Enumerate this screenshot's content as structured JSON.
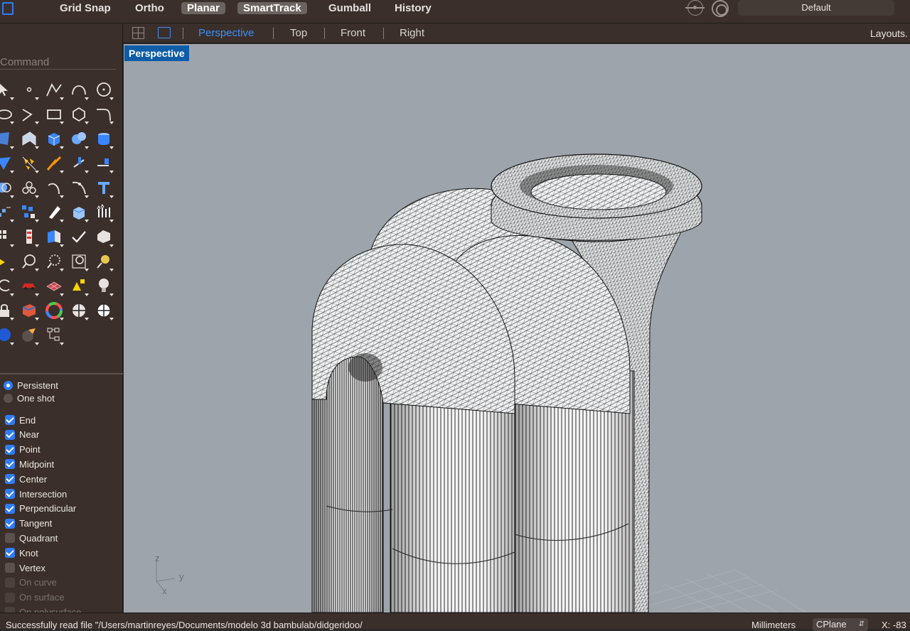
{
  "toolbar": {
    "buttons": [
      {
        "label": "Grid Snap",
        "active": false
      },
      {
        "label": "Ortho",
        "active": false
      },
      {
        "label": "Planar",
        "active": true
      },
      {
        "label": "SmartTrack",
        "active": true
      },
      {
        "label": "Gumball",
        "active": false
      },
      {
        "label": "History",
        "active": false
      }
    ],
    "layer_value": "Default"
  },
  "viewport_tabs": {
    "tabs": [
      {
        "label": "Perspective",
        "active": true
      },
      {
        "label": "Top",
        "active": false
      },
      {
        "label": "Front",
        "active": false
      },
      {
        "label": "Right",
        "active": false
      }
    ],
    "layouts_label": "Layouts."
  },
  "viewport": {
    "title": "Perspective",
    "axes": {
      "z": "z",
      "y": "y",
      "x": "x"
    }
  },
  "sidebar": {
    "command_placeholder": "Command",
    "tool_icons": [
      [
        "select-arrow-icon",
        "point-icon",
        "polyline-icon",
        "curve-icon",
        "circle-icon"
      ],
      [
        "ellipse-icon",
        "arc-icon",
        "rectangle-icon",
        "polygon-icon",
        "fillet-icon"
      ],
      [
        "surface-icon",
        "extrude-surface-icon",
        "box-icon",
        "sphere-icon",
        "cylinder-icon"
      ],
      [
        "patch-icon",
        "explode-icon",
        "split-icon",
        "trim-icon",
        "extend-icon"
      ],
      [
        "boolean-icon",
        "group-icon",
        "offset-icon",
        "curve-edit-icon",
        "text-icon"
      ],
      [
        "array-icon",
        "transform-icon",
        "mirror-icon",
        "solid-icon",
        "move-icon"
      ],
      [
        "grid-icon",
        "dimension-icon",
        "layer-icon",
        "check-icon",
        "analyze-icon"
      ],
      [
        "lasso-icon",
        "zoom-icon",
        "zoom-window-icon",
        "zoom-extents-icon",
        "light-icon"
      ],
      [
        "rotate-view-icon",
        "car-icon",
        "mesh-icon",
        "align-icon",
        "lightbulb-icon"
      ],
      [
        "lock-icon",
        "material-icon",
        "color-wheel-icon",
        "environment-icon",
        "sun-sphere-icon"
      ],
      [
        "render-icon",
        "flash-icon",
        "hierarchy-icon"
      ]
    ],
    "osnap_mode": [
      {
        "label": "Persistent",
        "selected": true
      },
      {
        "label": "One shot",
        "selected": false
      }
    ],
    "osnaps": [
      {
        "label": "End",
        "checked": true,
        "enabled": true
      },
      {
        "label": "Near",
        "checked": true,
        "enabled": true
      },
      {
        "label": "Point",
        "checked": true,
        "enabled": true
      },
      {
        "label": "Midpoint",
        "checked": true,
        "enabled": true
      },
      {
        "label": "Center",
        "checked": true,
        "enabled": true
      },
      {
        "label": "Intersection",
        "checked": true,
        "enabled": true
      },
      {
        "label": "Perpendicular",
        "checked": true,
        "enabled": true
      },
      {
        "label": "Tangent",
        "checked": true,
        "enabled": true
      },
      {
        "label": "Quadrant",
        "checked": false,
        "enabled": true
      },
      {
        "label": "Knot",
        "checked": true,
        "enabled": true
      },
      {
        "label": "Vertex",
        "checked": false,
        "enabled": true
      },
      {
        "label": "On curve",
        "checked": false,
        "enabled": false
      },
      {
        "label": "On surface",
        "checked": false,
        "enabled": false
      },
      {
        "label": "On polysurface",
        "checked": false,
        "enabled": false
      }
    ]
  },
  "statusbar": {
    "message": "Successfully read file \"/Users/martinreyes/Documents/modelo 3d bambulab/didgeridoo/",
    "units": "Millimeters",
    "cplane": "CPlane",
    "coord_x": "X: -83"
  },
  "colors": {
    "accent": "#2f7cf6",
    "viewport_bg": "#9ea4ab",
    "panel_bg": "#3a2f2b",
    "viewport_label_bg": "#0d5ca8"
  }
}
